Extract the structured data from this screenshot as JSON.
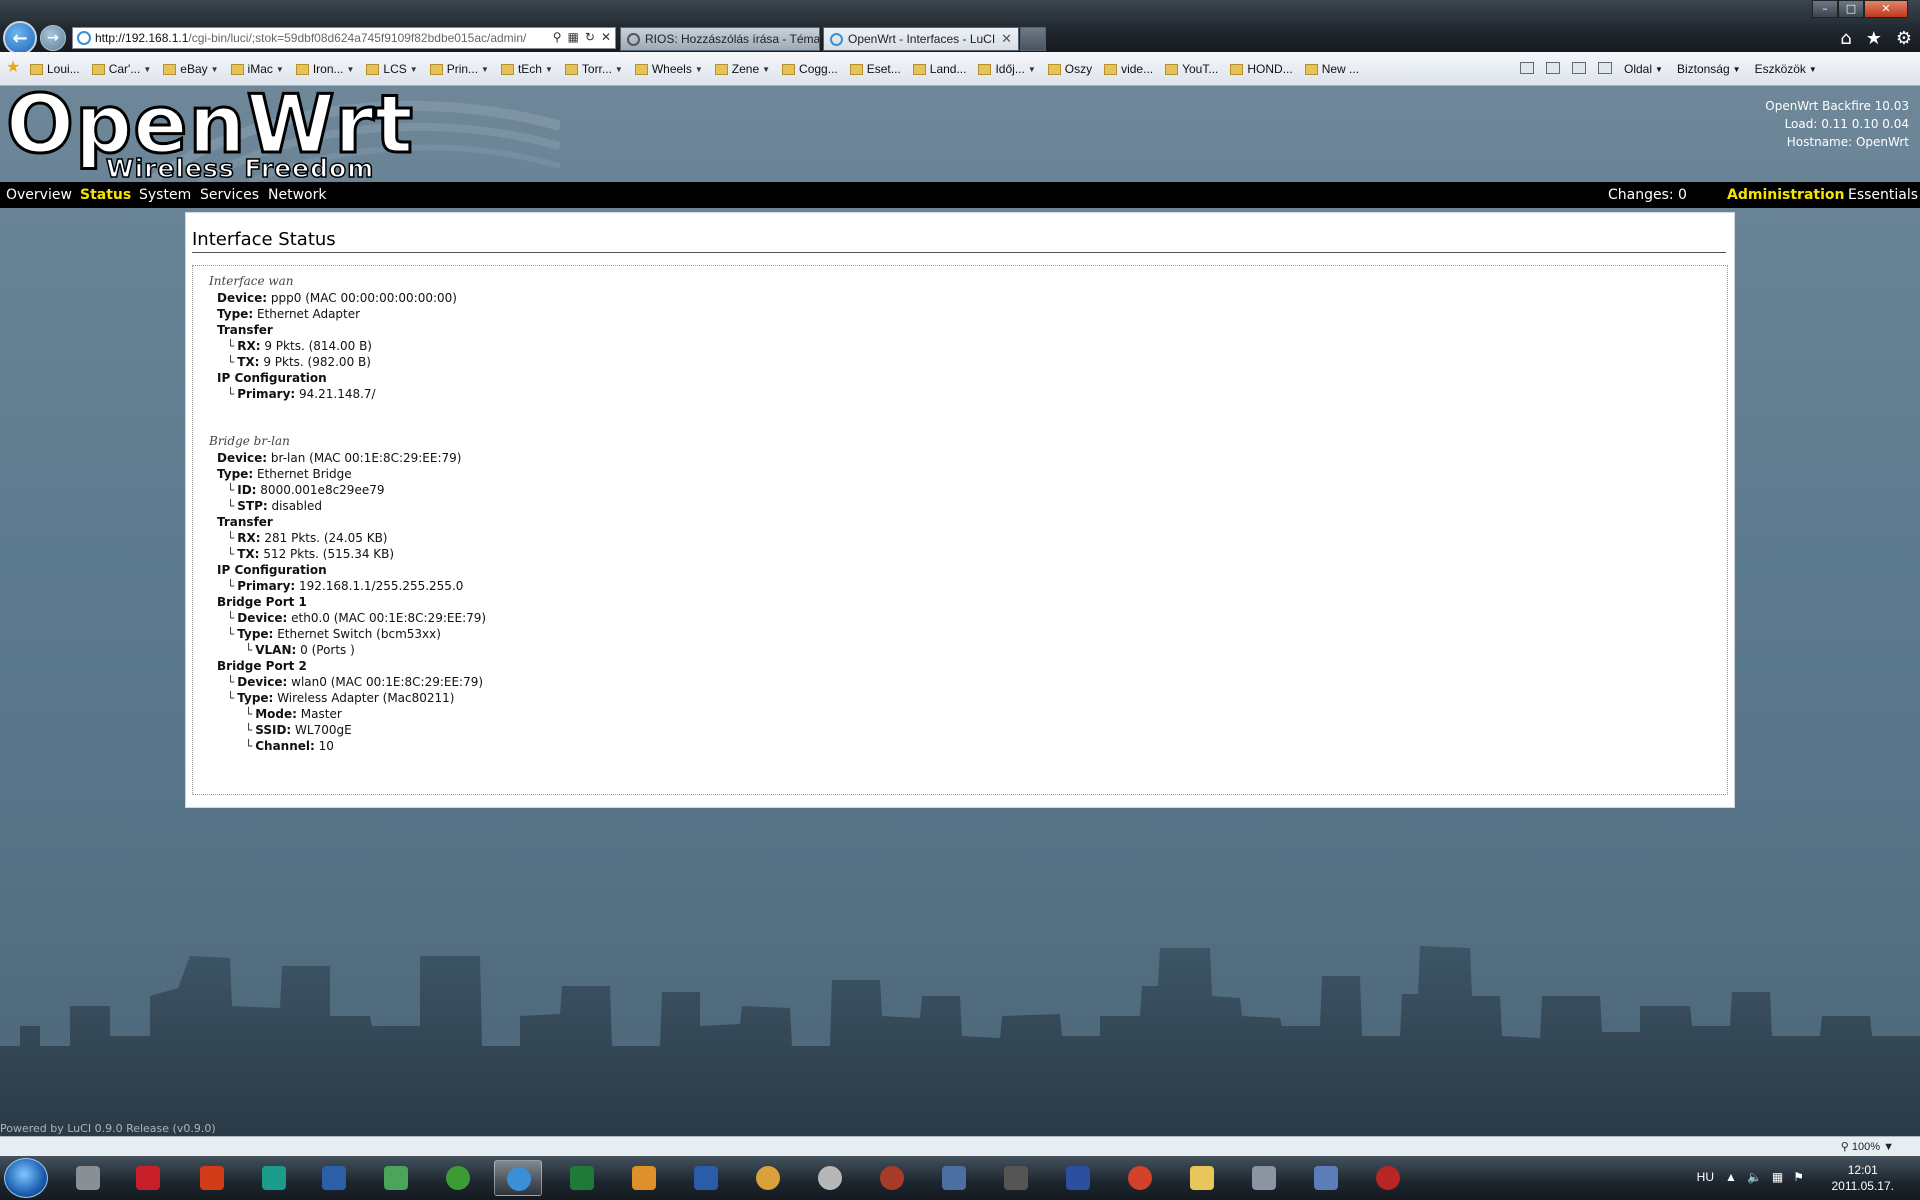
{
  "browser": {
    "address_host": "http://192.168.1.1",
    "address_path": "/cgi-bin/luci/;stok=59dbf08d624a745f9109f82bdbe015ac/admin/",
    "tabs": [
      {
        "label": "RIOS: Hozzászólás írása - Téma..."
      },
      {
        "label": "OpenWrt - Interfaces - LuCI"
      }
    ],
    "favorites": [
      {
        "label": "Loui...",
        "menu": false
      },
      {
        "label": "Car'...",
        "menu": true
      },
      {
        "label": "eBay",
        "menu": true
      },
      {
        "label": "iMac",
        "menu": true
      },
      {
        "label": "Iron...",
        "menu": true
      },
      {
        "label": "LCS",
        "menu": true
      },
      {
        "label": "Prin...",
        "menu": true
      },
      {
        "label": "tEch",
        "menu": true
      },
      {
        "label": "Torr...",
        "menu": true
      },
      {
        "label": "Wheels",
        "menu": true
      },
      {
        "label": "Zene",
        "menu": true
      },
      {
        "label": "Cogg...",
        "menu": false
      },
      {
        "label": "Eset...",
        "menu": false
      },
      {
        "label": "Land...",
        "menu": false
      },
      {
        "label": "Időj...",
        "menu": true
      },
      {
        "label": "Oszy",
        "menu": false
      },
      {
        "label": "vide...",
        "menu": false
      },
      {
        "label": "YouT...",
        "menu": false
      },
      {
        "label": "HOND...",
        "menu": false
      },
      {
        "label": "New ...",
        "menu": false
      }
    ],
    "commands": [
      "Oldal",
      "Biztonság",
      "Eszközök"
    ],
    "zoom": "100%"
  },
  "header": {
    "logo_main": "OpenWrt",
    "logo_sub": "Wireless Freedom",
    "version": "OpenWrt Backfire 10.03",
    "load": "Load: 0.11 0.10 0.04",
    "hostname": "Hostname: OpenWrt"
  },
  "nav": {
    "overview": "Overview",
    "status": "Status",
    "system": "System",
    "services": "Services",
    "network": "Network",
    "changes": "Changes: 0",
    "administration": "Administration",
    "essentials": "Essentials"
  },
  "content": {
    "title": "Interface Status",
    "wan": {
      "title": "Interface wan",
      "device_label": "Device:",
      "device": "ppp0 (MAC 00:00:00:00:00:00)",
      "type_label": "Type:",
      "type": "Ethernet Adapter",
      "transfer_label": "Transfer",
      "rx_label": "RX:",
      "rx": "9 Pkts. (814.00 B)",
      "tx_label": "TX:",
      "tx": "9 Pkts. (982.00 B)",
      "ipconf_label": "IP Configuration",
      "primary_label": "Primary:",
      "primary": "94.21.148.7/"
    },
    "lan": {
      "title": "Bridge br-lan",
      "device_label": "Device:",
      "device": "br-lan (MAC 00:1E:8C:29:EE:79)",
      "type_label": "Type:",
      "type": "Ethernet Bridge",
      "id_label": "ID:",
      "id": "8000.001e8c29ee79",
      "stp_label": "STP:",
      "stp": "disabled",
      "transfer_label": "Transfer",
      "rx_label": "RX:",
      "rx": "281 Pkts. (24.05 KB)",
      "tx_label": "TX:",
      "tx": "512 Pkts. (515.34 KB)",
      "ipconf_label": "IP Configuration",
      "primary_label": "Primary:",
      "primary": "192.168.1.1/255.255.255.0",
      "port1_label": "Bridge Port 1",
      "p1_device_label": "Device:",
      "p1_device": "eth0.0 (MAC 00:1E:8C:29:EE:79)",
      "p1_type_label": "Type:",
      "p1_type": "Ethernet Switch (bcm53xx)",
      "p1_vlan_label": "VLAN:",
      "p1_vlan": "0 (Ports )",
      "port2_label": "Bridge Port 2",
      "p2_device_label": "Device:",
      "p2_device": "wlan0 (MAC 00:1E:8C:29:EE:79)",
      "p2_type_label": "Type:",
      "p2_type": "Wireless Adapter (Mac80211)",
      "p2_mode_label": "Mode:",
      "p2_mode": "Master",
      "p2_ssid_label": "SSID:",
      "p2_ssid": "WL700gE",
      "p2_channel_label": "Channel:",
      "p2_channel": "10"
    }
  },
  "footer": "Powered by LuCI 0.9.0 Release (v0.9.0)",
  "taskbar": {
    "lang": "HU",
    "time": "12:01",
    "date": "2011.05.17."
  },
  "colors": {
    "nav_active": "#f5e400",
    "nav_bg": "#000000",
    "page_bg": "#5e7a8d"
  }
}
